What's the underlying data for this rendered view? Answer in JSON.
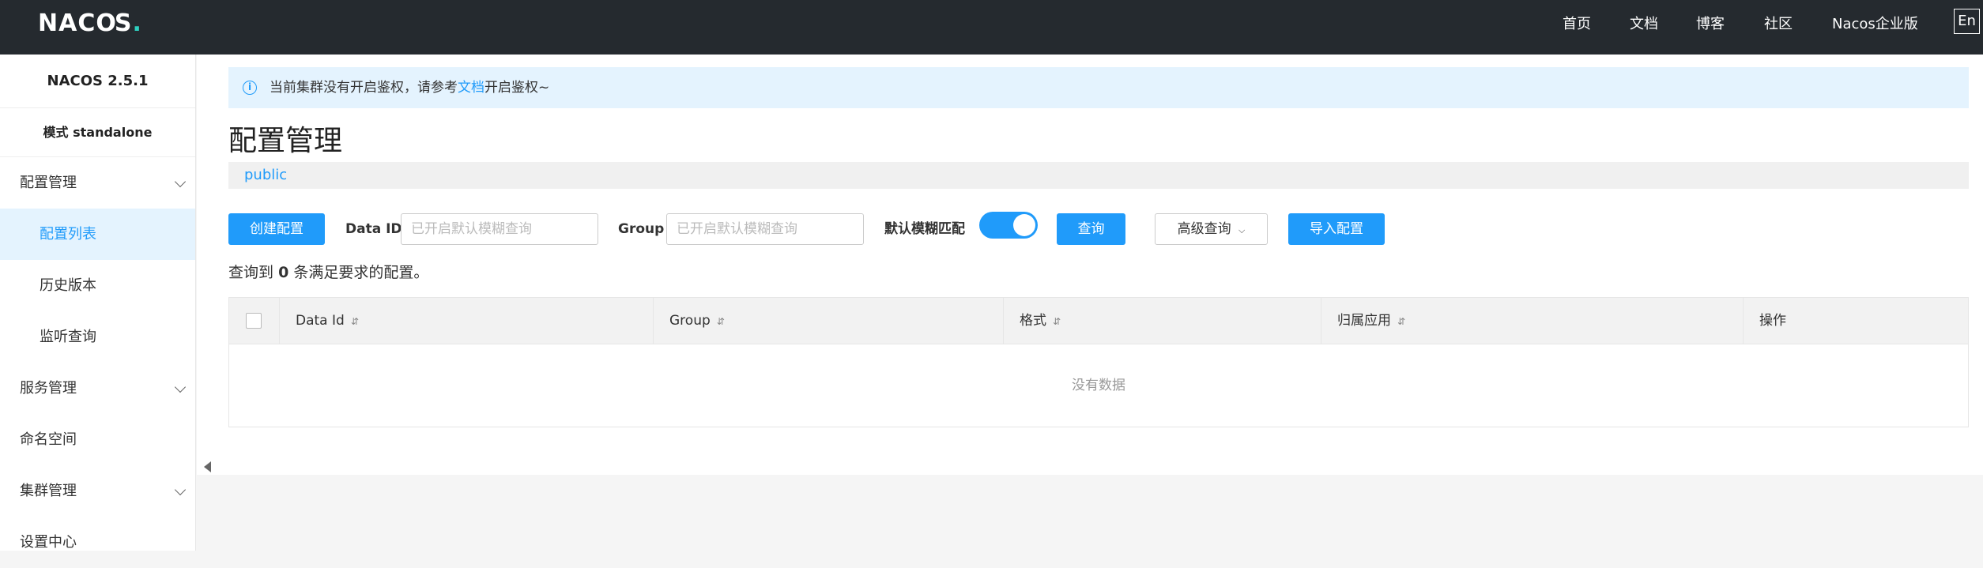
{
  "header": {
    "logo": "NACOS.",
    "nav": [
      "首页",
      "文档",
      "博客",
      "社区",
      "Nacos企业版"
    ],
    "lang_button": "En"
  },
  "sidebar": {
    "version": "NACOS 2.5.1",
    "mode": "模式 standalone",
    "items": [
      {
        "label": "配置管理",
        "expandable": true
      },
      {
        "label": "配置列表",
        "sub": true,
        "active": true
      },
      {
        "label": "历史版本",
        "sub": true
      },
      {
        "label": "监听查询",
        "sub": true
      },
      {
        "label": "服务管理",
        "expandable": true
      },
      {
        "label": "命名空间"
      },
      {
        "label": "集群管理",
        "expandable": true
      },
      {
        "label": "设置中心"
      }
    ]
  },
  "notice": {
    "prefix": "当前集群没有开启鉴权，请参考",
    "link": "文档",
    "suffix": "开启鉴权~"
  },
  "page_title": "配置管理",
  "namespace": "public",
  "toolbar": {
    "create_label": "创建配置",
    "data_id_label": "Data ID",
    "data_id_placeholder": "已开启默认模糊查询",
    "group_label": "Group",
    "group_placeholder": "已开启默认模糊查询",
    "fuzzy_label": "默认模糊匹配",
    "fuzzy_enabled": true,
    "query_label": "查询",
    "advanced_label": "高级查询",
    "import_label": "导入配置"
  },
  "result": {
    "prefix": "查询到",
    "count": "0",
    "suffix": "条满足要求的配置。"
  },
  "table": {
    "columns": [
      "Data Id",
      "Group",
      "格式",
      "归属应用",
      "操作"
    ],
    "empty_text": "没有数据"
  },
  "colors": {
    "accent": "#209bfa",
    "topbar": "#252a2f"
  }
}
